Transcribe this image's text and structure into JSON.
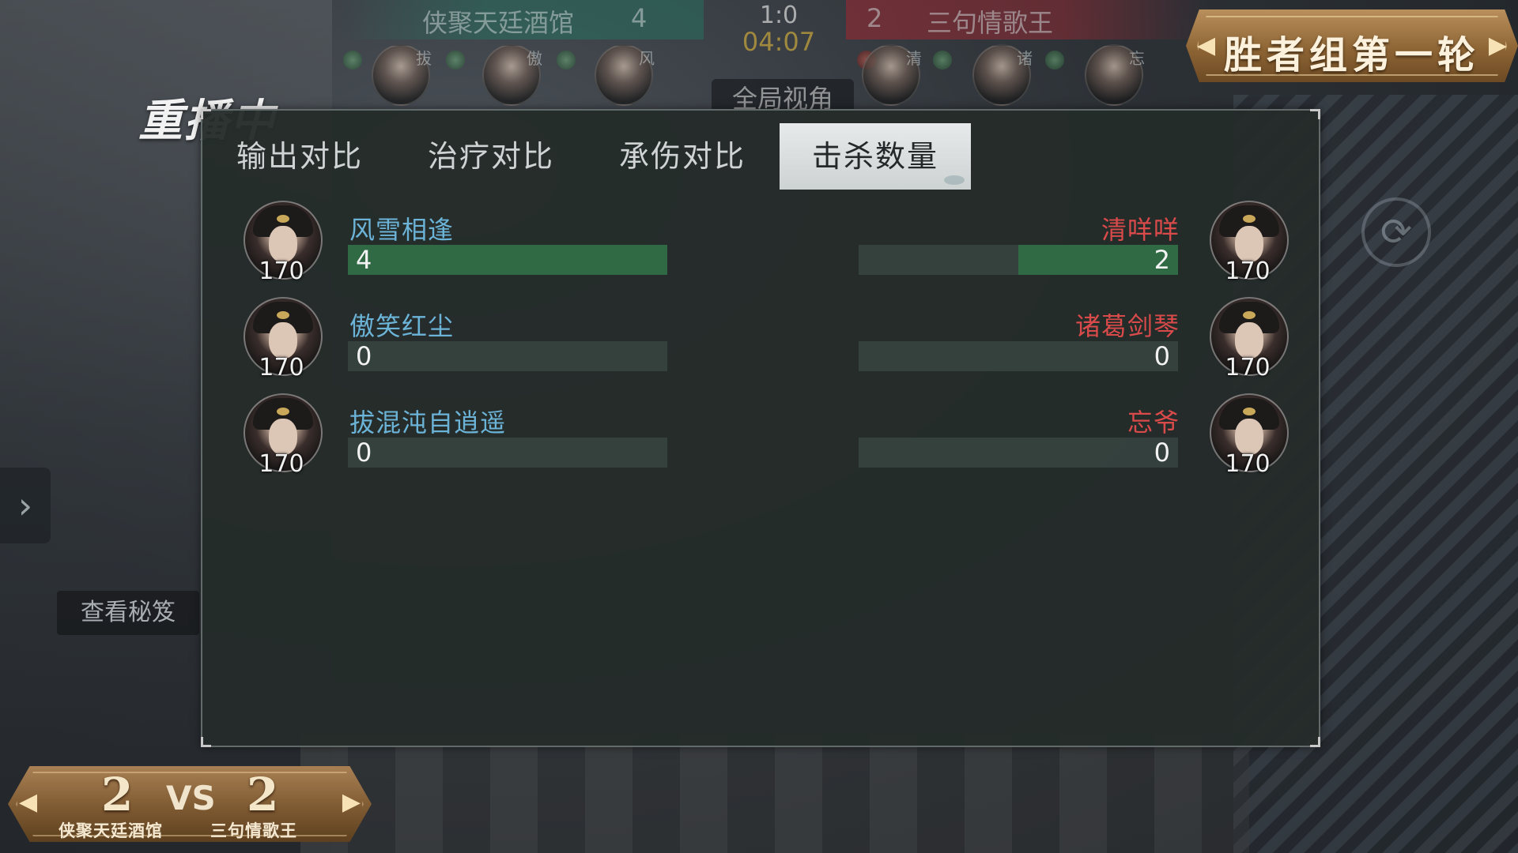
{
  "hud": {
    "team_left": "侠聚天廷酒馆",
    "team_left_score": "4",
    "match_score": "1:0",
    "timer": "04:07",
    "team_right_score": "2",
    "team_right": "三句情歌王",
    "view_label": "全局视角",
    "hero_tags_left": [
      "拔",
      "傲",
      "风"
    ],
    "hero_tags_right": [
      "清",
      "诸",
      "忘"
    ]
  },
  "round_badge": {
    "title": "胜者组第一轮"
  },
  "replay_label": "重播中",
  "left_cheat_button": "查看秘笈",
  "tabs": [
    {
      "label": "输出对比",
      "active": false
    },
    {
      "label": "治疗对比",
      "active": false
    },
    {
      "label": "承伤对比",
      "active": false
    },
    {
      "label": "击杀数量",
      "active": true
    }
  ],
  "rows": [
    {
      "left": {
        "name": "风雪相逢",
        "level": "170",
        "value": 4,
        "display": "4"
      },
      "right": {
        "name": "清咩咩",
        "level": "170",
        "value": 2,
        "display": "2"
      }
    },
    {
      "left": {
        "name": "傲笑红尘",
        "level": "170",
        "value": 0,
        "display": "0"
      },
      "right": {
        "name": "诸葛剑琴",
        "level": "170",
        "value": 0,
        "display": "0"
      }
    },
    {
      "left": {
        "name": "拔混沌自逍遥",
        "level": "170",
        "value": 0,
        "display": "0"
      },
      "right": {
        "name": "忘爷",
        "level": "170",
        "value": 0,
        "display": "0"
      }
    }
  ],
  "bar_max": 4,
  "score_badge": {
    "left_score": "2",
    "vs": "VS",
    "right_score": "2",
    "left_team": "侠聚天廷酒馆",
    "right_team": "三句情歌王"
  },
  "colors": {
    "left_name": "#6cb3d8",
    "right_name": "#d94a4a",
    "bar_fill": "#2f6a45",
    "timer": "#c2a23c"
  }
}
